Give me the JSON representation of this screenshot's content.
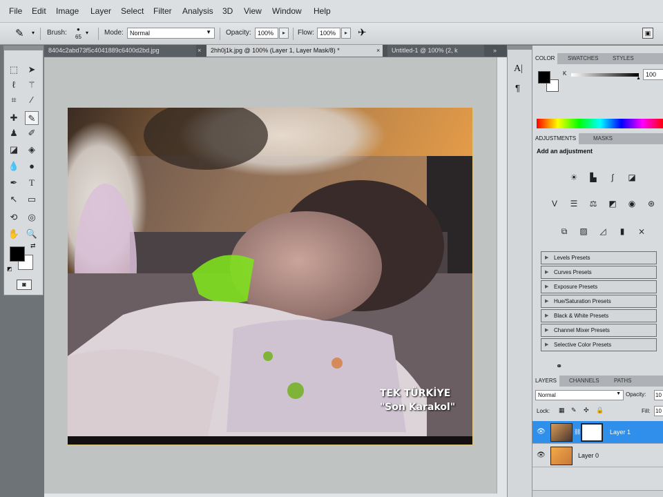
{
  "menu": [
    "File",
    "Edit",
    "Image",
    "Layer",
    "Select",
    "Filter",
    "Analysis",
    "3D",
    "View",
    "Window",
    "Help"
  ],
  "options": {
    "brush_label": "Brush:",
    "brush_size": "65",
    "mode_label": "Mode:",
    "mode_value": "Normal",
    "opacity_label": "Opacity:",
    "opacity_value": "100%",
    "flow_label": "Flow:",
    "flow_value": "100%"
  },
  "doc_tabs": [
    {
      "label": "8404c2abd73f5c4041889c6400d2bd.jpg"
    },
    {
      "label": "2hh0j1k.jpg @ 100% (Layer 1, Layer Mask/8) *"
    },
    {
      "label": "Untitled-1 @ 100% (2, k"
    }
  ],
  "doc_tabs_more": "»",
  "photo": {
    "caption_title": "TEK TÜRKİYE",
    "caption_sub": "\"Son Karakol\""
  },
  "color_panel": {
    "tabs": [
      "COLOR",
      "SWATCHES",
      "STYLES"
    ],
    "channel_label": "K",
    "channel_value": "100"
  },
  "adjustments": {
    "tabs": [
      "ADJUSTMENTS",
      "MASKS"
    ],
    "heading": "Add an adjustment",
    "presets": [
      "Levels Presets",
      "Curves Presets",
      "Exposure Presets",
      "Hue/Saturation Presets",
      "Black & White Presets",
      "Channel Mixer Presets",
      "Selective Color Presets"
    ]
  },
  "layers": {
    "tabs": [
      "LAYERS",
      "CHANNELS",
      "PATHS"
    ],
    "blend_mode": "Normal",
    "opacity_label": "Opacity:",
    "opacity_value": "10",
    "lock_label": "Lock:",
    "fill_label": "Fill:",
    "fill_value": "10",
    "items": [
      {
        "name": "Layer 1",
        "selected": true
      },
      {
        "name": "Layer 0",
        "selected": false
      }
    ]
  },
  "colors": {
    "selection": "#2f8fea",
    "foreground": "#000000",
    "background": "#ffffff"
  }
}
